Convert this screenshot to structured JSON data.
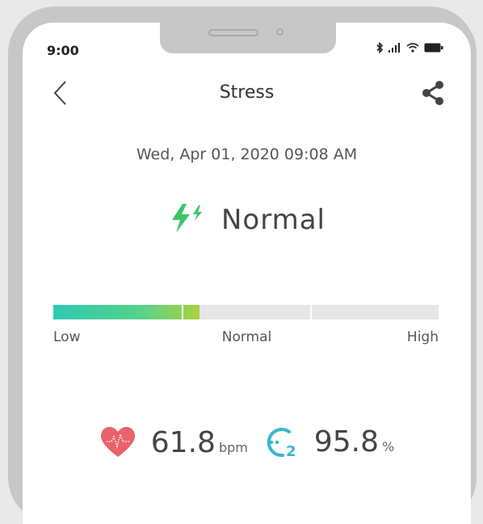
{
  "status_bar": {
    "time": "9:00"
  },
  "header": {
    "title": "Stress"
  },
  "measurement": {
    "timestamp": "Wed, Apr 01, 2020 09:08 AM",
    "level": "Normal"
  },
  "stress_bar": {
    "labels": {
      "low": "Low",
      "normal": "Normal",
      "high": "High"
    },
    "fill_fraction": 0.38,
    "colors": {
      "start": "#2ec9b3",
      "end": "#a9d23e",
      "track": "#e6e6e6"
    }
  },
  "metrics": {
    "heart_rate": {
      "value": "61.8",
      "unit": "bpm",
      "icon": "heart-icon",
      "color": "#e8626a"
    },
    "spo2": {
      "value": "95.8",
      "unit": "%",
      "icon": "o2-icon",
      "color": "#3bb6cf"
    }
  },
  "colors": {
    "accent_green": "#3cc46b"
  }
}
